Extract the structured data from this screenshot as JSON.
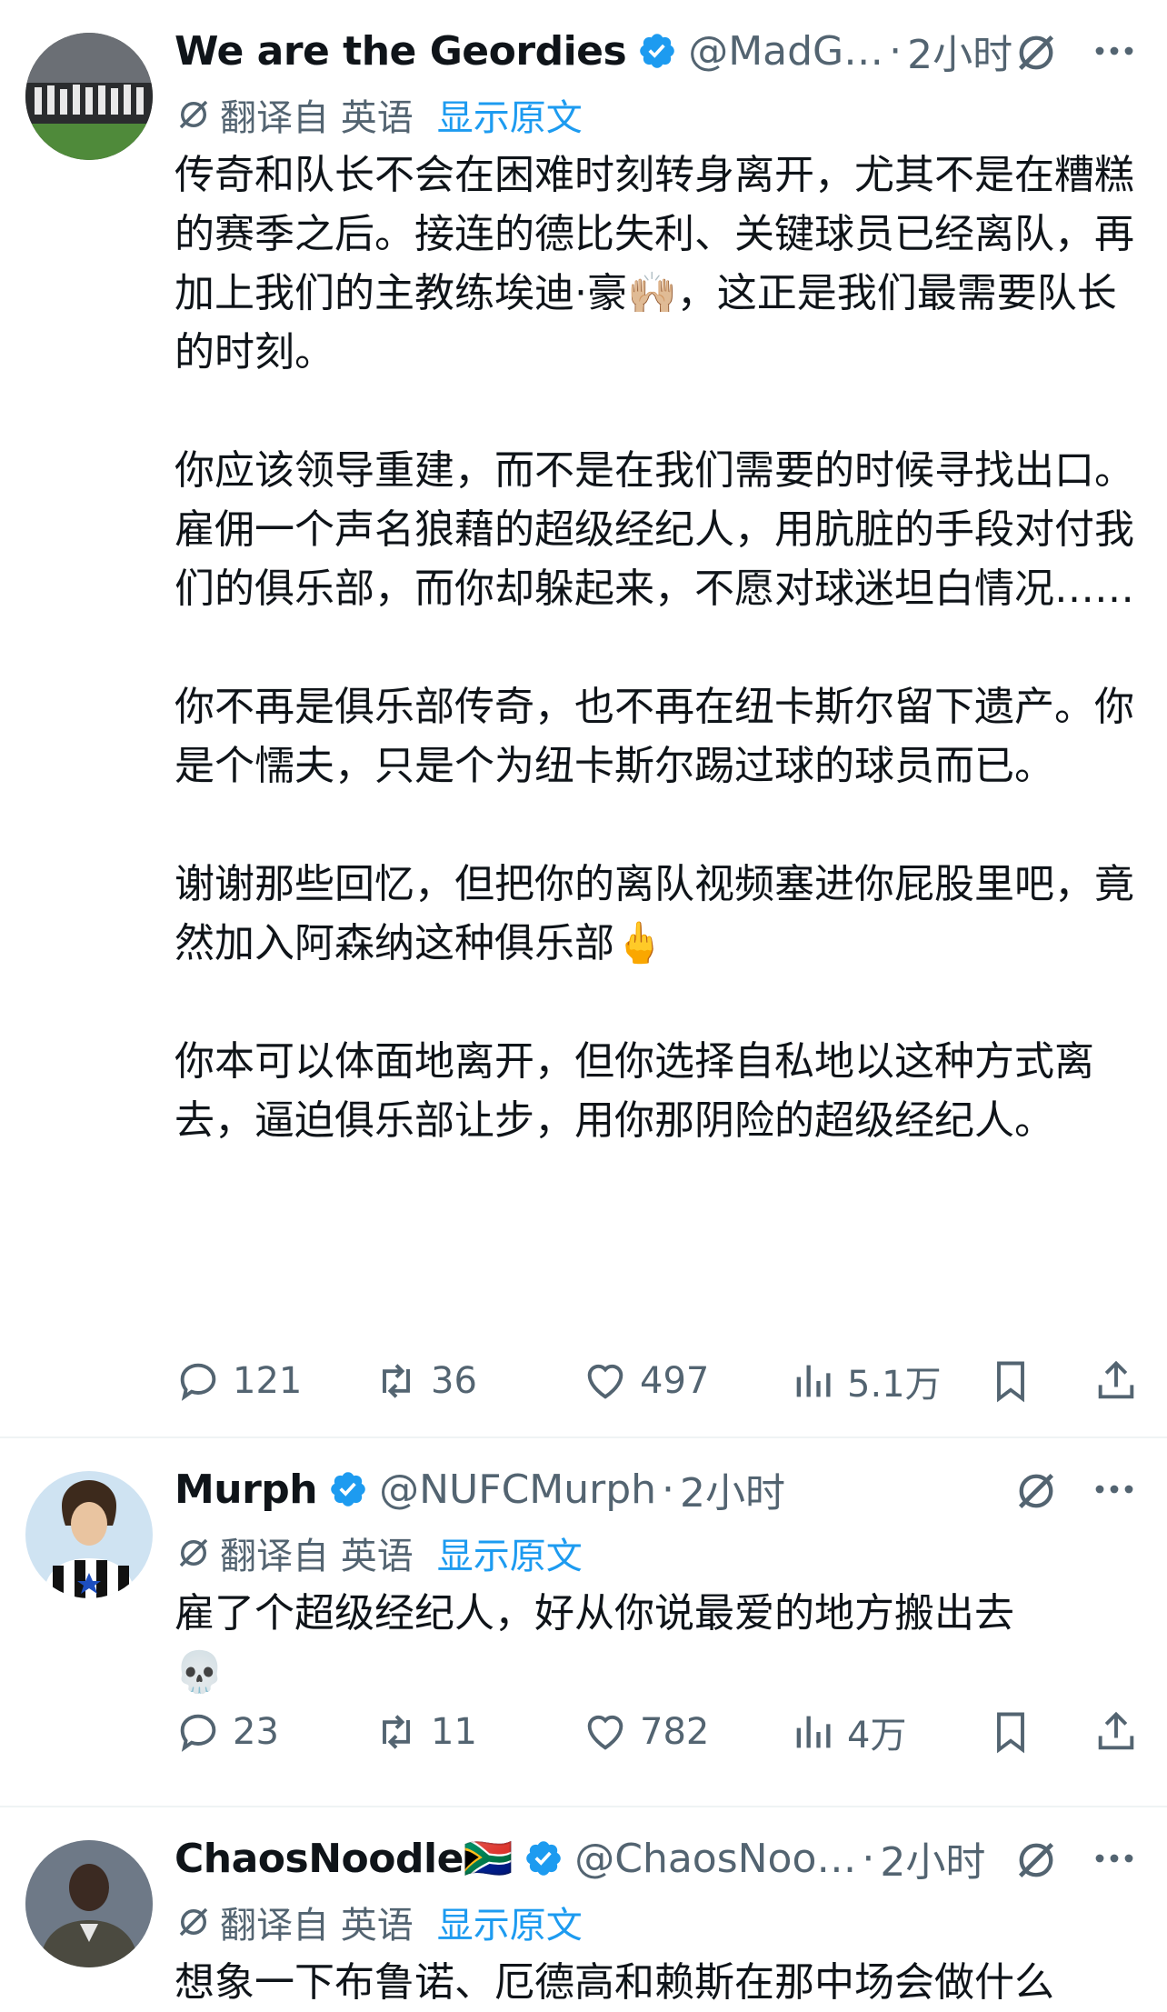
{
  "tweets": [
    {
      "name": "We are the Geordies",
      "handle": "@MadG…",
      "dot": "·",
      "time": "2小时",
      "translate_label": "翻译自 英语",
      "show_original": "显示原文",
      "body": "传奇和队长不会在困难时刻转身离开，尤其不是在糟糕的赛季之后。接连的德比失利、关键球员已经离队，再加上我们的主教练埃迪·豪🙌🏼，这正是我们最需要队长的时刻。\n\n你应该领导重建，而不是在我们需要的时候寻找出口。雇佣一个声名狼藉的超级经纪人，用肮脏的手段对付我们的俱乐部，而你却躲起来，不愿对球迷坦白情况……\n\n你不再是俱乐部传奇，也不再在纽卡斯尔留下遗产。你是个懦夫，只是个为纽卡斯尔踢过球的球员而已。\n\n谢谢那些回忆，但把你的离队视频塞进你屁股里吧，竟然加入阿森纳这种俱乐部🖕\n\n你本可以体面地离开，但你选择自私地以这种方式离去，逼迫俱乐部让步，用你那阴险的超级经纪人。",
      "replies": "121",
      "retweets": "36",
      "likes": "497",
      "views": "5.1万"
    },
    {
      "name": "Murph",
      "handle": "@NUFCMurph",
      "dot": "·",
      "time": "2小时",
      "translate_label": "翻译自 英语",
      "show_original": "显示原文",
      "body": "雇了个超级经纪人，好从你说最爱的地方搬出去\n💀",
      "replies": "23",
      "retweets": "11",
      "likes": "782",
      "views": "4万"
    },
    {
      "name": "ChaosNoodle🇿🇦",
      "handle": "@ChaosNoo…",
      "dot": "·",
      "time": "2小时",
      "translate_label": "翻译自 英语",
      "show_original": "显示原文",
      "body": "想象一下布鲁诺、厄德高和赖斯在那中场会做什么"
    }
  ],
  "colors": {
    "text": "#0f1419",
    "secondary": "#536471",
    "link": "#1d9bf0",
    "verified": "#1d9bf0",
    "divider": "#eff3f4"
  },
  "icons": [
    "verified-badge-icon",
    "grok-icon",
    "more-icon",
    "translate-icon",
    "reply-icon",
    "retweet-icon",
    "like-icon",
    "views-icon",
    "bookmark-icon",
    "share-icon"
  ]
}
